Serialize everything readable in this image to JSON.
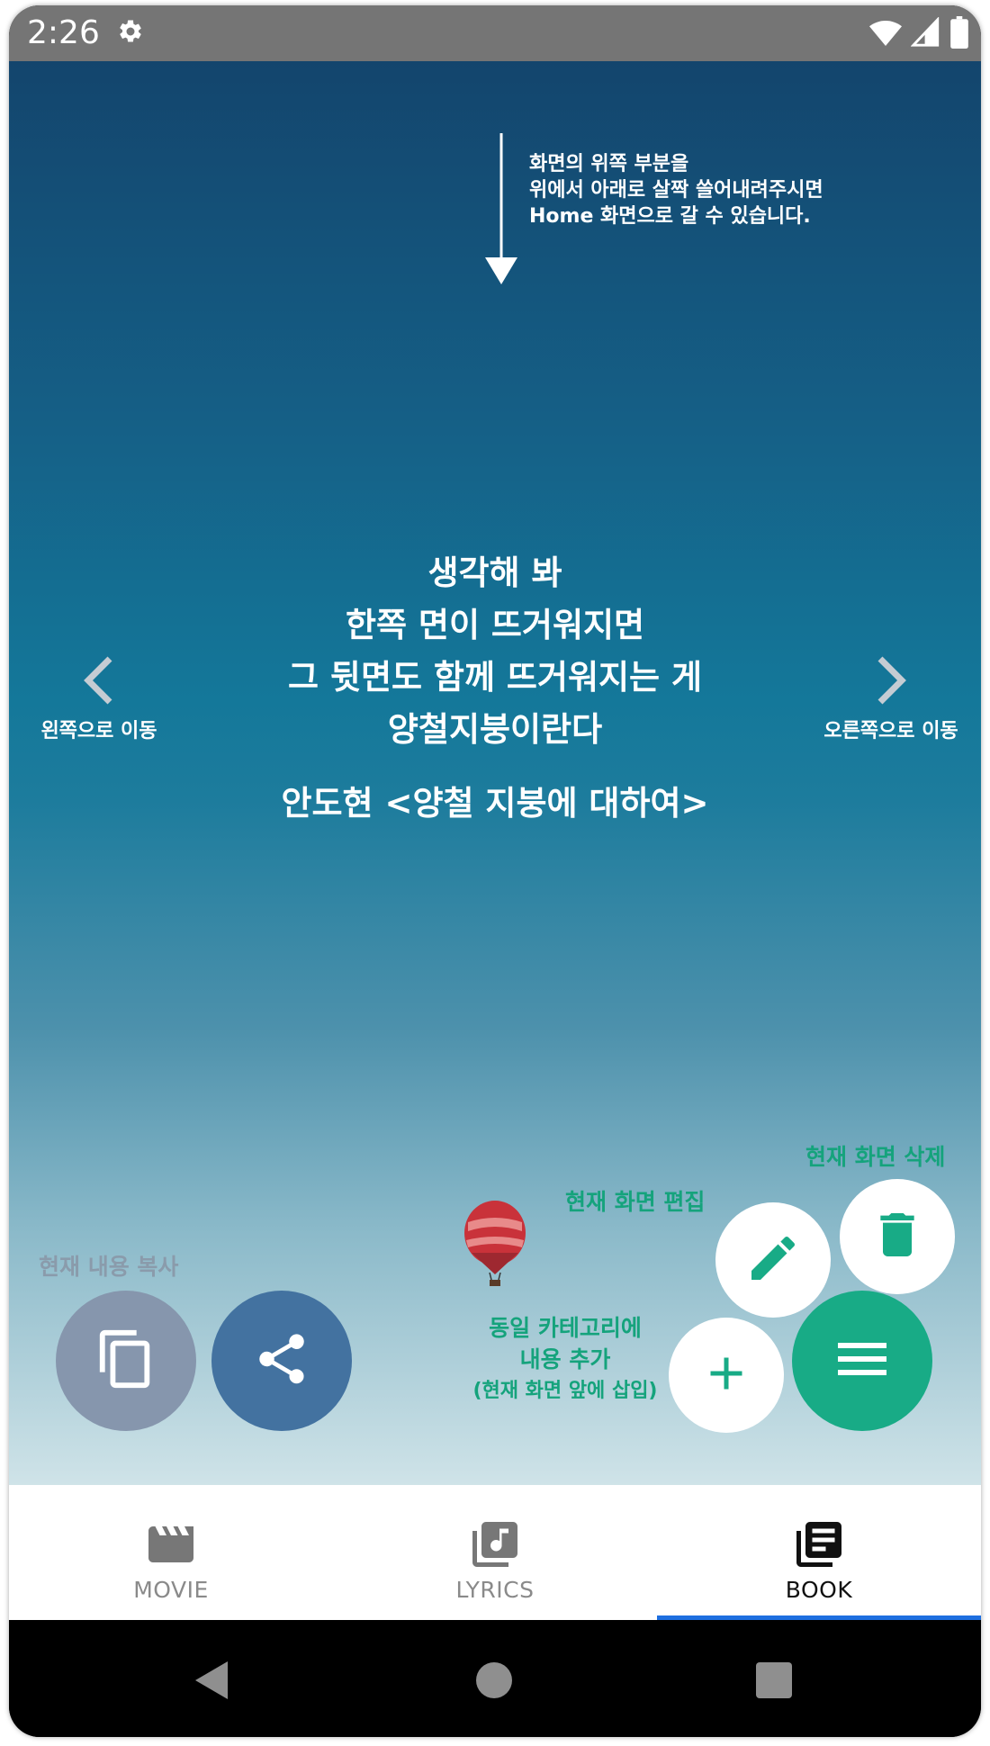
{
  "status_bar": {
    "time": "2:26"
  },
  "hint": {
    "lines": [
      "화면의 위쪽 부분을",
      "위에서 아래로 살짝 쓸어내려주시면",
      "Home 화면으로 갈 수 있습니다."
    ]
  },
  "quote": {
    "lines": [
      "생각해 봐",
      "한쪽 면이 뜨거워지면",
      "그 뒷면도 함께 뜨거워지는 게",
      "양철지붕이란다"
    ],
    "author": "안도현 <양철 지붕에 대하여>"
  },
  "navigation": {
    "left_label": "왼쪽으로 이동",
    "right_label": "오른쪽으로 이동"
  },
  "actions": {
    "copy_label": "현재 내용 복사",
    "edit_label": "현재 화면 편집",
    "delete_label": "현재 화면 삭제",
    "add_label_line1": "동일 카테고리에",
    "add_label_line2": "내용 추가",
    "add_label_line3": "(현재 화면 앞에 삽입)"
  },
  "tabs": [
    {
      "label": "MOVIE",
      "icon": "movie-clapper-icon"
    },
    {
      "label": "LYRICS",
      "icon": "music-library-icon"
    },
    {
      "label": "BOOK",
      "icon": "book-library-icon",
      "active": true
    }
  ],
  "colors": {
    "accent_green": "#18ab86",
    "share_blue": "#4372a0",
    "copy_gray": "#8696ad",
    "tab_indicator": "#1e6fe0"
  }
}
